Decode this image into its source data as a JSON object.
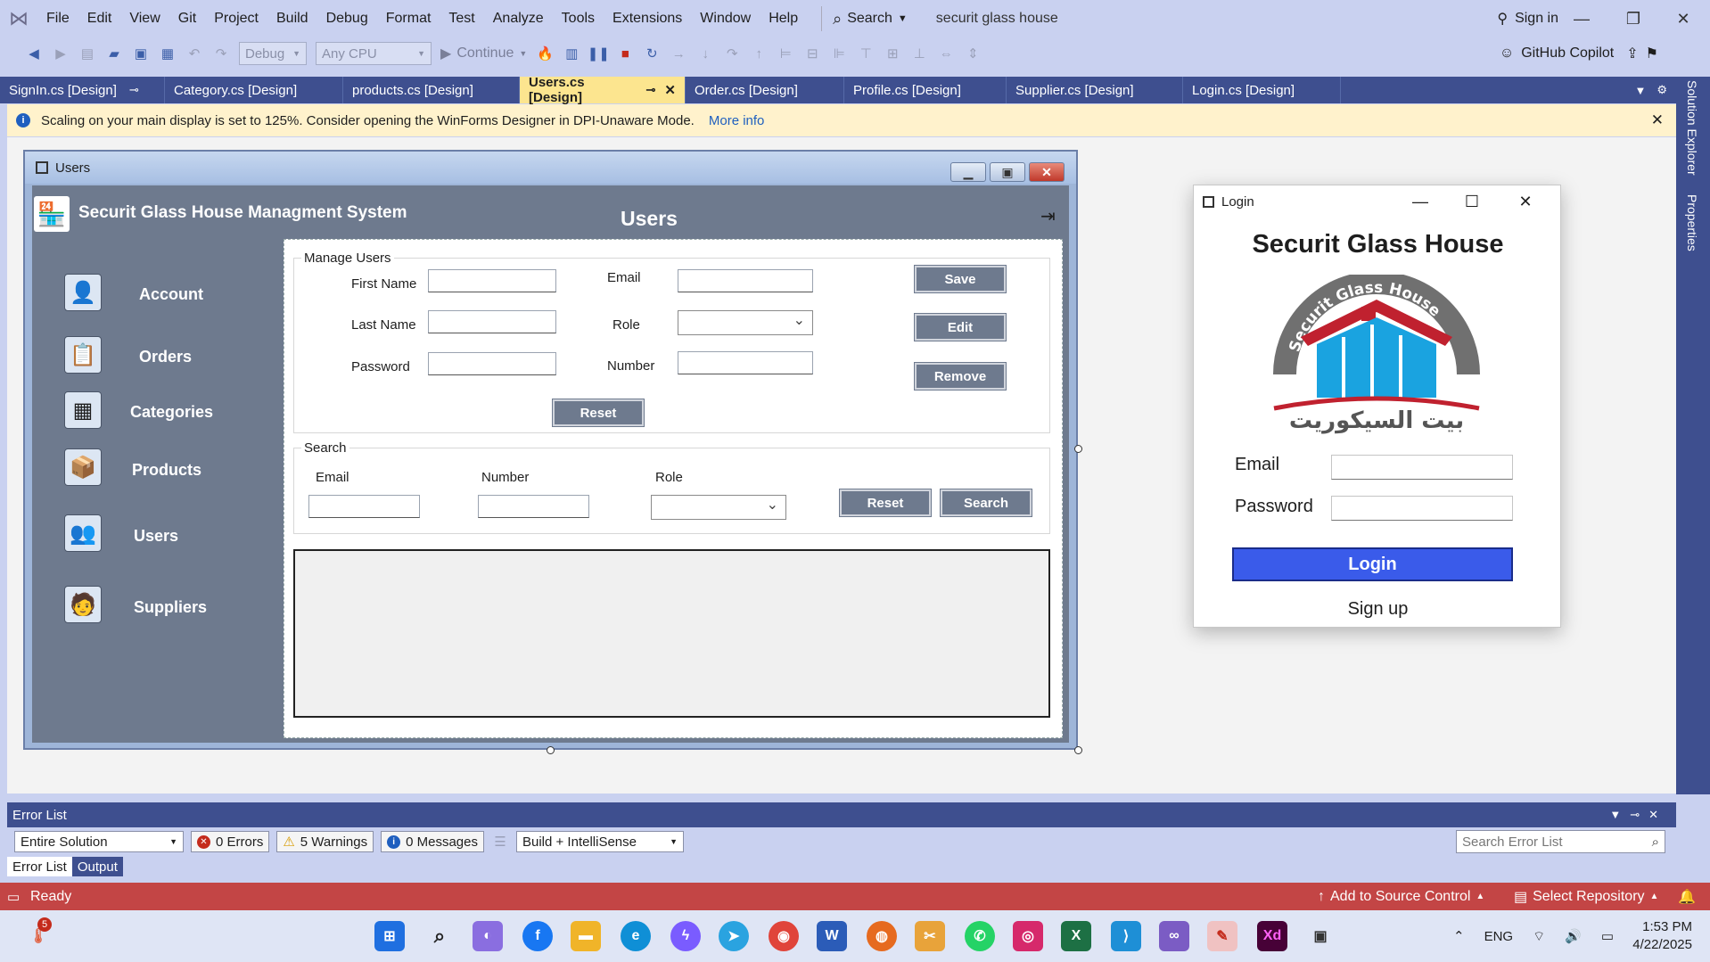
{
  "menubar": {
    "items": [
      "File",
      "Edit",
      "View",
      "Git",
      "Project",
      "Build",
      "Debug",
      "Format",
      "Test",
      "Analyze",
      "Tools",
      "Extensions",
      "Window",
      "Help"
    ],
    "search_label": "Search",
    "solution_name": "securit glass house",
    "signin_label": "Sign in"
  },
  "toolbar": {
    "config": "Debug",
    "platform": "Any CPU",
    "continue_label": "Continue",
    "copilot_label": "GitHub Copilot"
  },
  "tabs": [
    {
      "label": "SignIn.cs [Design]"
    },
    {
      "label": "Category.cs [Design]"
    },
    {
      "label": "products.cs [Design]"
    },
    {
      "label": "Users.cs [Design]"
    },
    {
      "label": "Order.cs [Design]"
    },
    {
      "label": "Profile.cs [Design]"
    },
    {
      "label": "Supplier.cs [Design]"
    },
    {
      "label": "Login.cs [Design]"
    }
  ],
  "right_dock": {
    "solution_explorer": "Solution Explorer",
    "properties": "Properties"
  },
  "infobar": {
    "message": "Scaling on your main display is set to 125%. Consider opening the WinForms Designer in DPI-Unaware Mode.",
    "link": "More info"
  },
  "users_form": {
    "window_title": "Users",
    "app_name": "Securit Glass House Managment System",
    "heading": "Users",
    "nav": [
      "Account",
      "Orders",
      "Categories",
      "Products",
      "Users",
      "Suppliers"
    ],
    "manage": {
      "group_title": "Manage Users",
      "first_name": "First Name",
      "last_name": "Last Name",
      "password": "Password",
      "email": "Email",
      "role": "Role",
      "number": "Number",
      "save": "Save",
      "edit": "Edit",
      "remove": "Remove",
      "reset": "Reset"
    },
    "search": {
      "group_title": "Search",
      "email": "Email",
      "number": "Number",
      "role": "Role",
      "reset": "Reset",
      "search": "Search"
    }
  },
  "login_form": {
    "window_title": "Login",
    "heading": "Securit Glass House",
    "logo_text": "Securit Glass House",
    "logo_arabic": "بيت السيكوريت",
    "email_label": "Email",
    "password_label": "Password",
    "login_button": "Login",
    "signup_link": "Sign up"
  },
  "error_list": {
    "title": "Error List",
    "scope": "Entire Solution",
    "errors": "0 Errors",
    "warnings": "5 Warnings",
    "messages": "0 Messages",
    "build_filter": "Build + IntelliSense",
    "search_placeholder": "Search Error List",
    "tab_errors": "Error List",
    "tab_output": "Output"
  },
  "statusbar": {
    "ready": "Ready",
    "add_source": "Add to Source Control",
    "select_repo": "Select Repository"
  },
  "taskbar": {
    "notification_count": "5",
    "language": "ENG",
    "time": "1:53 PM",
    "date": "4/22/2025"
  }
}
